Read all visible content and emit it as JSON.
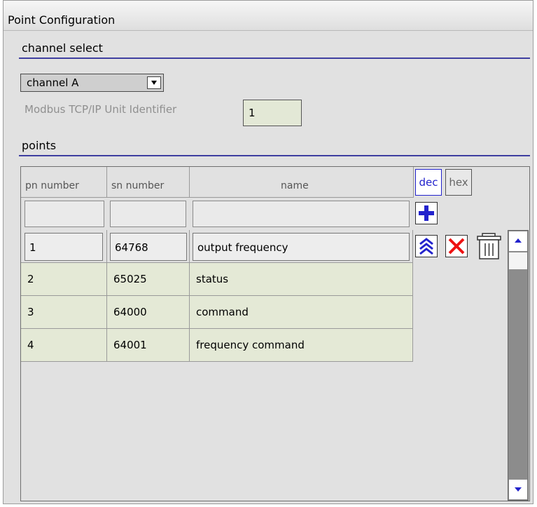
{
  "title": "Point Configuration",
  "channel_section": {
    "label": "channel select"
  },
  "channel_select": {
    "value": "channel A"
  },
  "unit_id": {
    "label": "Modbus TCP/IP Unit Identifier",
    "value": "1"
  },
  "points_section": {
    "label": "points"
  },
  "table": {
    "columns": [
      "pn number",
      "sn number",
      "name"
    ],
    "format_toggle": {
      "dec": "dec",
      "hex": "hex",
      "selected": "dec"
    },
    "filter": {
      "pn": "",
      "sn": "",
      "name": ""
    },
    "rows": [
      {
        "pn": "1",
        "sn": "64768",
        "name": "output frequency",
        "editing": true
      },
      {
        "pn": "2",
        "sn": "65025",
        "name": "status",
        "editing": false
      },
      {
        "pn": "3",
        "sn": "64000",
        "name": "command",
        "editing": false
      },
      {
        "pn": "4",
        "sn": "64001",
        "name": "frequency command",
        "editing": false
      }
    ]
  },
  "icons": {
    "add": "plus-icon",
    "move_top": "double-chevron-up-icon",
    "cancel": "close-icon",
    "delete": "trash-icon",
    "scroll_up": "arrow-up-icon",
    "scroll_down": "arrow-down-icon"
  },
  "colors": {
    "accent": "#2222cc",
    "rule": "#3f3fa0",
    "row_bg": "#e4e9d6",
    "delete_red": "#ee1111"
  }
}
